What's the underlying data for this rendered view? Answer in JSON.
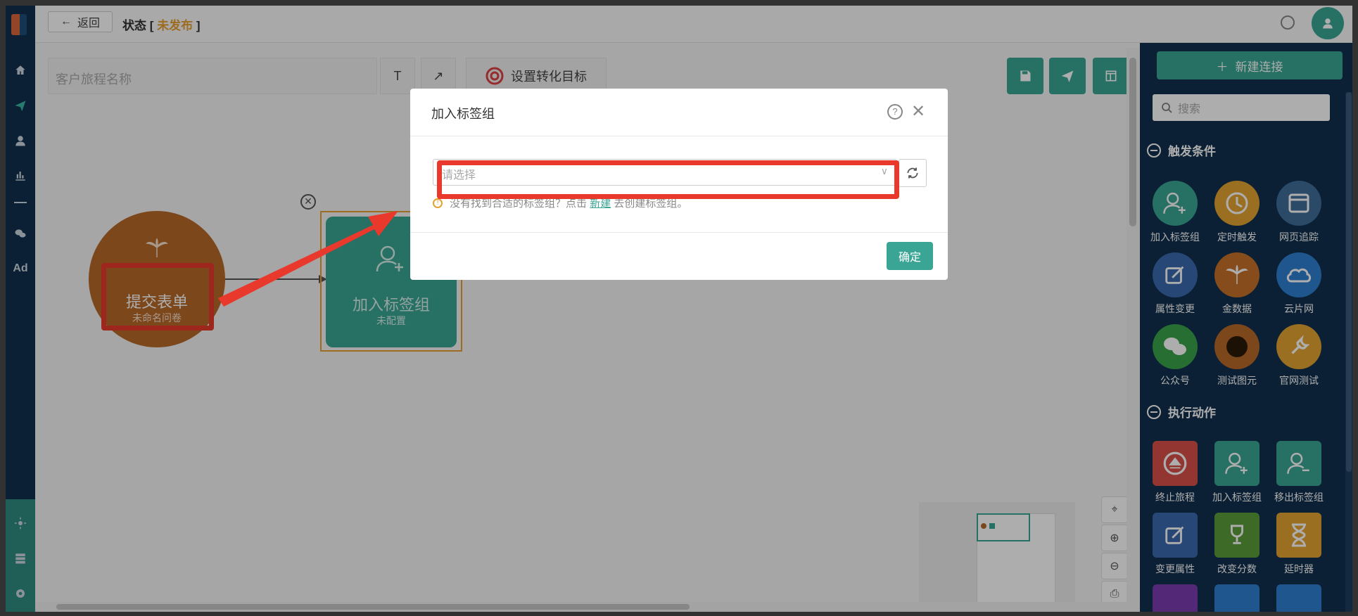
{
  "header": {
    "back_label": "返回",
    "status_label": "状态",
    "status_value": "未发布"
  },
  "toolbar": {
    "journey_name_placeholder": "客户旅程名称",
    "text_tool": "T",
    "arrow_tool": "↗",
    "goal_label": "设置转化目标"
  },
  "canvas": {
    "trigger_node": {
      "title": "提交表单",
      "subtitle": "未命名问卷"
    },
    "action_node": {
      "title": "加入标签组",
      "subtitle": "未配置"
    }
  },
  "right_panel": {
    "new_connection_label": "新建连接",
    "search_placeholder": "搜索",
    "sections": [
      {
        "title": "触发条件",
        "items": [
          "加入标签组",
          "定时触发",
          "网页追踪",
          "属性变更",
          "金数据",
          "云片网",
          "公众号",
          "测试图元",
          "官网测试"
        ]
      },
      {
        "title": "执行动作",
        "items": [
          "终止旅程",
          "加入标签组",
          "移出标签组",
          "变更属性",
          "改变分数",
          "延时器"
        ]
      }
    ]
  },
  "modal": {
    "title": "加入标签组",
    "select_placeholder": "请选择",
    "hint_prefix": "没有找到合适的标签组？点击",
    "hint_link": "新建",
    "hint_suffix": "去创建标签组。",
    "confirm_label": "确定"
  },
  "colors": {
    "primary": "#3aa594",
    "sidebar": "#11304d",
    "trigger_orange": "#b8692a",
    "highlight_red": "#e8392c",
    "status_orange": "#e6a030"
  }
}
